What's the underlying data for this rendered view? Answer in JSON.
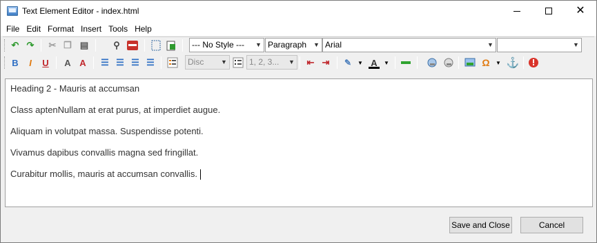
{
  "window": {
    "title": "Text Element Editor - index.html"
  },
  "menu": [
    "File",
    "Edit",
    "Format",
    "Insert",
    "Tools",
    "Help"
  ],
  "toolbar": {
    "style_combo": "--- No Style ---",
    "block_combo": "Paragraph",
    "font_combo": "Arial",
    "size_combo": "",
    "list_style_combo": "Disc",
    "numbering_combo": "1, 2, 3...",
    "bold_glyph": "B",
    "italic_glyph": "I",
    "underline_glyph": "U",
    "font_size_glyph": "A",
    "superscript_glyph": "A",
    "omega_glyph": "Ω"
  },
  "colors": {
    "highlight": "#4f81bd",
    "font_color": "#000000",
    "bold": "#2e6fc4",
    "italic": "#e07a10",
    "underline": "#c0282d",
    "green_line": "#2fa32f",
    "error": "#d9342b"
  },
  "content": {
    "paragraphs": [
      "Heading 2 - Mauris at accumsan",
      "Class aptenNullam at erat purus, at imperdiet augue.",
      "Aliquam in volutpat massa. Suspendisse potenti.",
      "Vivamus dapibus convallis magna sed fringillat.",
      "Curabitur mollis, mauris at accumsan convallis."
    ]
  },
  "buttons": {
    "save": "Save and Close",
    "cancel": "Cancel"
  }
}
